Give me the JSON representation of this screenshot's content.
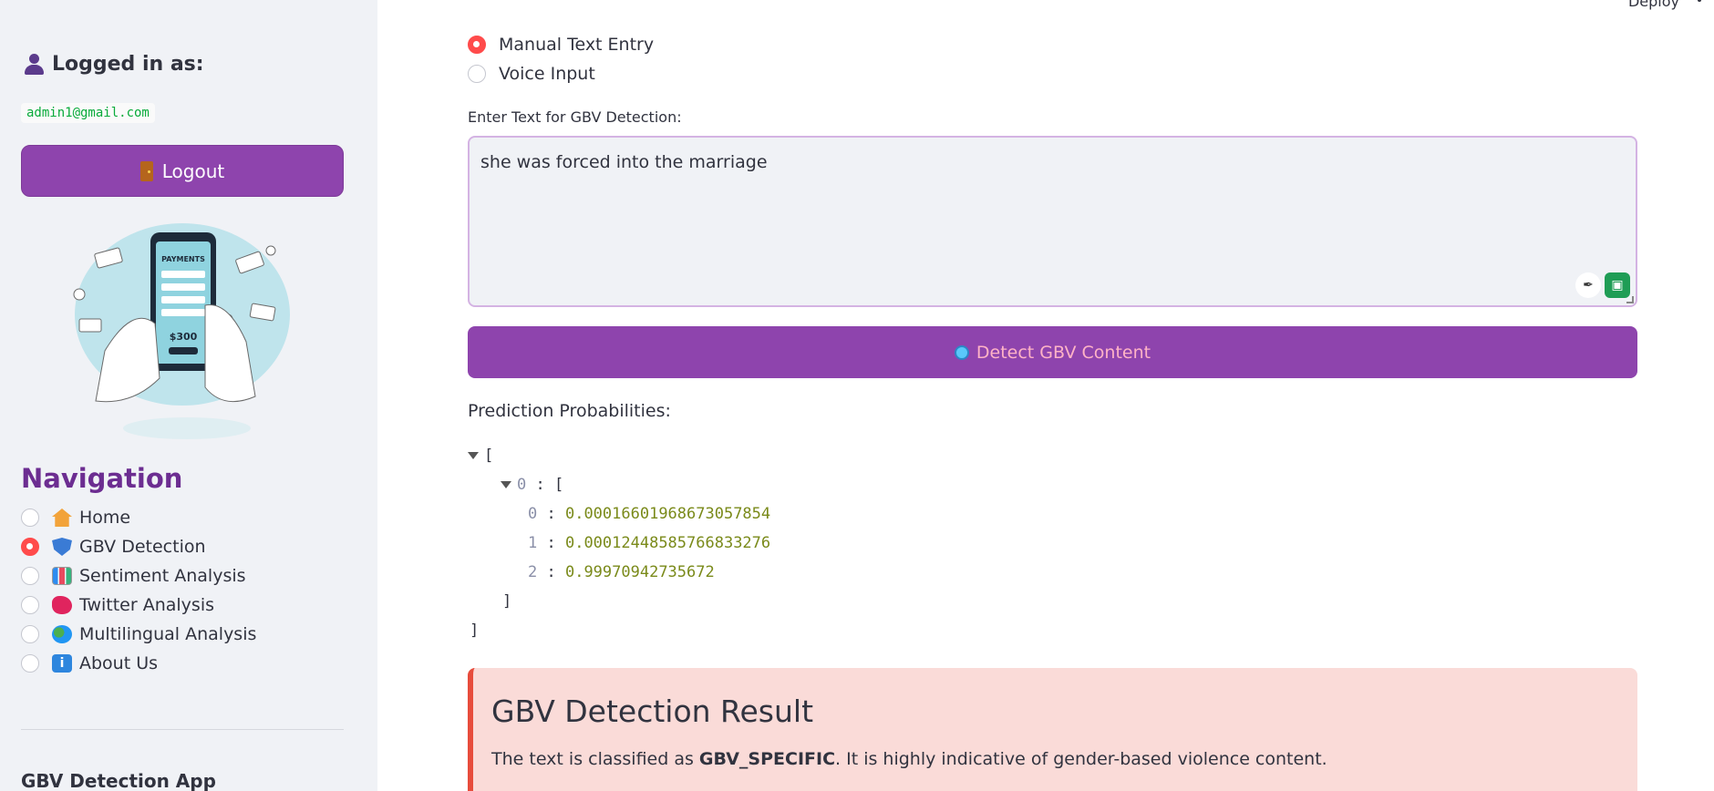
{
  "sidebar": {
    "logged_in_label": "Logged in as:",
    "email": "admin1@gmail.com",
    "logout_label": "Logout",
    "nav_title": "Navigation",
    "nav_items": [
      {
        "label": "Home",
        "icon": "house-icon",
        "selected": false
      },
      {
        "label": "GBV Detection",
        "icon": "shield-icon",
        "selected": true
      },
      {
        "label": "Sentiment Analysis",
        "icon": "bar-chart-icon",
        "selected": false
      },
      {
        "label": "Twitter Analysis",
        "icon": "twitter-icon",
        "selected": false
      },
      {
        "label": "Multilingual Analysis",
        "icon": "globe-icon",
        "selected": false
      },
      {
        "label": "About Us",
        "icon": "info-icon",
        "selected": false
      }
    ],
    "footer_title": "GBV Detection App"
  },
  "header": {
    "deploy_label": "Deploy"
  },
  "input_mode": {
    "options": [
      {
        "label": "Manual Text Entry",
        "selected": true
      },
      {
        "label": "Voice Input",
        "selected": false
      }
    ]
  },
  "text_input": {
    "label": "Enter Text for GBV Detection:",
    "value": "she was forced into the marriage"
  },
  "detect_button": {
    "label": "Detect GBV Content"
  },
  "prediction": {
    "label": "Prediction Probabilities:",
    "outer_index": "0",
    "values": [
      {
        "index": "0",
        "value": "0.00016601968673057854"
      },
      {
        "index": "1",
        "value": "0.00012448585766833276"
      },
      {
        "index": "2",
        "value": "0.99970942735672"
      }
    ]
  },
  "result": {
    "title": "GBV Detection Result",
    "text_prefix": "The text is classified as ",
    "class_label": "GBV_SPECIFIC",
    "text_suffix": ". It is highly indicative of gender-based violence content."
  },
  "colors": {
    "accent": "#8e44ad",
    "nav_title": "#6c2d91",
    "radio_selected": "#ff4b4b",
    "result_bg": "#fadbd8",
    "result_border": "#e74c3c"
  }
}
